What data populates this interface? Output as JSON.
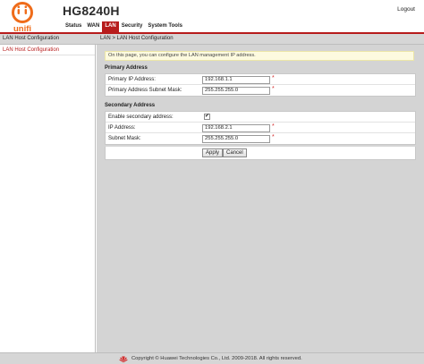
{
  "header": {
    "brand_text": "unifi",
    "model": "HG8240H",
    "logout_label": "Logout"
  },
  "nav": {
    "items": [
      {
        "label": "Status"
      },
      {
        "label": "WAN"
      },
      {
        "label": "LAN",
        "active": true
      },
      {
        "label": "Security"
      },
      {
        "label": "System Tools"
      }
    ]
  },
  "subbar": {
    "section": "LAN Host Configuration",
    "breadcrumb": "LAN > LAN Host Configuration"
  },
  "sidebar": {
    "items": [
      {
        "label": "LAN Host Configuration"
      }
    ]
  },
  "main": {
    "info": "On this page, you can configure the LAN management IP address.",
    "primary": {
      "title": "Primary Address",
      "ip_label": "Primary IP Address:",
      "ip_value": "192.168.1.1",
      "mask_label": "Primary Address Subnet Mask:",
      "mask_value": "255.255.255.0"
    },
    "secondary": {
      "title": "Secondary Address",
      "enable_label": "Enable secondary address:",
      "enable_mark": "✔",
      "ip_label": "IP Address:",
      "ip_value": "192.168.2.1",
      "mask_label": "Subnet Mask:",
      "mask_value": "255.255.255.0"
    },
    "required_mark": "*",
    "apply_label": "Apply",
    "cancel_label": "Cancel"
  },
  "footer": {
    "copyright": "Copyright © Huawei Technologies Co., Ltd. 2009-2018. All rights reserved."
  },
  "colors": {
    "accent": "#b71c1c",
    "logo_orange": "#ef6c1a",
    "panel_bg": "#d4d4d4"
  },
  "icons": [
    "unifi-logo",
    "huawei-logo-icon",
    "checkbox-check-icon"
  ]
}
